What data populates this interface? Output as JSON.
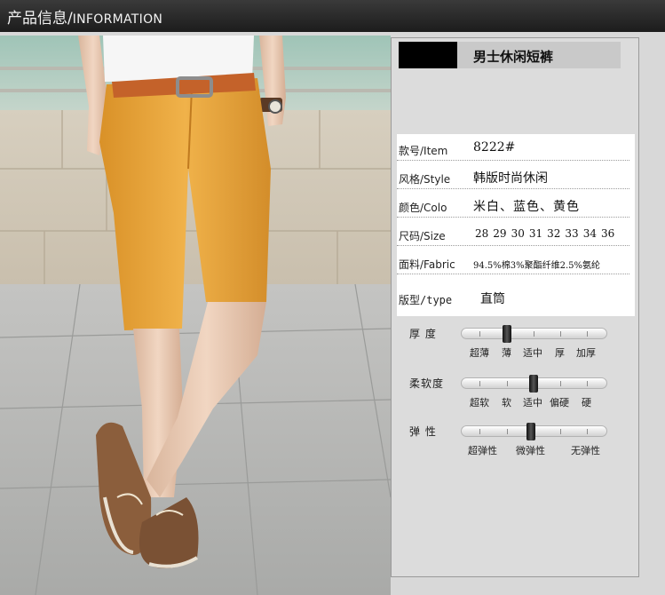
{
  "header": {
    "title_cn": "产品信息",
    "title_sep": "/",
    "title_en": "INFORMATION"
  },
  "product": {
    "name": "男士休闲短裤"
  },
  "specs": [
    {
      "key": "款号/Item",
      "value": "8222#"
    },
    {
      "key": "风格/Style",
      "value": "韩版时尚休闲"
    },
    {
      "key": "颜色/Colo",
      "value": "米白、蓝色、黄色"
    },
    {
      "key": "尺码/Size",
      "sizes": [
        "28",
        "29",
        "30",
        "31",
        "32",
        "33",
        "34",
        "36"
      ]
    },
    {
      "key": "面料/Fabric",
      "value": "94.5%棉3%聚酯纤维2.5%氨纶"
    },
    {
      "key": "版型/type",
      "value": "直筒"
    }
  ],
  "sliders": [
    {
      "label": "厚 度",
      "options": [
        "超薄",
        "薄",
        "适中",
        "厚",
        "加厚"
      ],
      "selected": "薄"
    },
    {
      "label": "柔软度",
      "options": [
        "超软",
        "软",
        "适中",
        "偏硬",
        "硬"
      ],
      "selected": "适中"
    },
    {
      "label": "弹 性",
      "options": [
        "超弹性",
        "微弹性",
        "无弹性"
      ],
      "selected": "微弹性"
    }
  ],
  "colors": {
    "header_bg": "#262626",
    "shorts": "#e9a73a",
    "belt": "#c4622a",
    "panel_bg": "#dcdcdc"
  }
}
